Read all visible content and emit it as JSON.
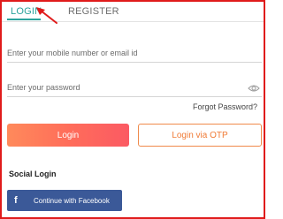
{
  "tabs": [
    {
      "label": "LOGIN",
      "active": true
    },
    {
      "label": "REGISTER",
      "active": false
    }
  ],
  "form": {
    "mobile_placeholder": "Enter your mobile number or email id",
    "mobile_value": "",
    "password_placeholder": "Enter your password",
    "password_value": "",
    "forgot_label": "Forgot Password?",
    "login_label": "Login",
    "otp_label": "Login via OTP"
  },
  "social": {
    "heading": "Social Login",
    "facebook_label": "Continue with Facebook",
    "facebook_icon": "f"
  },
  "icons": {
    "password_toggle": "eye-icon",
    "facebook": "facebook-icon",
    "annotation": "red-arrow"
  },
  "colors": {
    "accent": "#2ba39c",
    "frame_border": "#e01b1b",
    "login_gradient_start": "#ff8a5b",
    "login_gradient_end": "#fb5a63",
    "otp_border": "#f08a4b",
    "facebook_blue": "#3b5998"
  }
}
